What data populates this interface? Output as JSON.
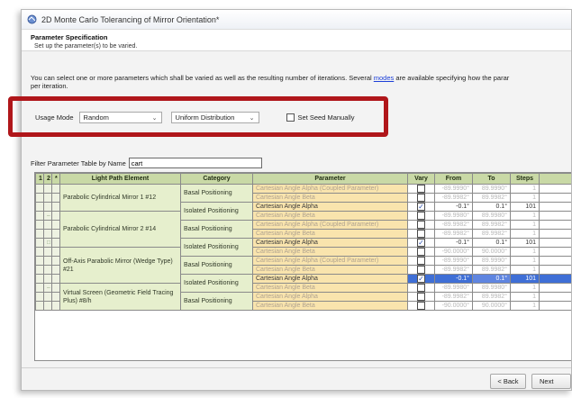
{
  "window": {
    "title": "2D Monte Carlo Tolerancing of Mirror Orientation*"
  },
  "header": {
    "section_title": "Parameter Specification",
    "section_subtitle": "Set up the parameter(s) to be varied."
  },
  "info": {
    "text_before": "You can select one or more parameters which shall be varied as well as the resulting number of iterations. Several ",
    "link": "modes",
    "text_after": " are available specifying how the parar",
    "line2": "per iteration."
  },
  "mode": {
    "label": "Usage Mode",
    "mode_value": "Random",
    "distribution_value": "Uniform Distribution",
    "seed_label": "Set Seed Manually"
  },
  "filter": {
    "label": "Filter Parameter Table by Name",
    "value": "cart"
  },
  "table": {
    "headers": [
      "1",
      "2",
      "*",
      "Light Path Element",
      "Category",
      "Parameter",
      "Vary",
      "From",
      "To",
      "Steps"
    ],
    "tree_markers": [
      "–",
      "□",
      "–"
    ],
    "elements": [
      "Parabolic Cylindrical Mirror 1 #12",
      "Parabolic Cylindrical Mirror 2 #14",
      "Off-Axis Parabolic Mirror (Wedge Type) #21",
      "Virtual Screen (Geometric Field Tracing Plus) #8/h"
    ],
    "categories": [
      "Basal Positioning",
      "Isolated Positioning",
      "Basal Positioning",
      "Isolated Positioning",
      "Basal Positioning",
      "Isolated Positioning",
      "Basal Positioning"
    ],
    "rows": [
      {
        "param": "Cartesian Angle Alpha (Coupled Parameter)",
        "vary": false,
        "from": "-89.9990°",
        "to": "89.9990°",
        "steps": "1"
      },
      {
        "param": "Cartesian Angle Beta",
        "vary": false,
        "from": "-89.9982°",
        "to": "89.9982°",
        "steps": "1"
      },
      {
        "param": "Cartesian Angle Alpha",
        "vary": true,
        "from": "-0.1°",
        "to": "0.1°",
        "steps": "101"
      },
      {
        "param": "Cartesian Angle Beta",
        "vary": false,
        "from": "-89.9980°",
        "to": "89.9980°",
        "steps": "1"
      },
      {
        "param": "Cartesian Angle Alpha (Coupled Parameter)",
        "vary": false,
        "from": "-89.9982°",
        "to": "89.9982°",
        "steps": "1"
      },
      {
        "param": "Cartesian Angle Beta",
        "vary": false,
        "from": "-89.9982°",
        "to": "89.9982°",
        "steps": "1"
      },
      {
        "param": "Cartesian Angle Alpha",
        "vary": true,
        "from": "-0.1°",
        "to": "0.1°",
        "steps": "101"
      },
      {
        "param": "Cartesian Angle Beta",
        "vary": false,
        "from": "-90.0000°",
        "to": "90.0000°",
        "steps": "1"
      },
      {
        "param": "Cartesian Angle Alpha (Coupled Parameter)",
        "vary": false,
        "from": "-89.9990°",
        "to": "89.9990°",
        "steps": "1"
      },
      {
        "param": "Cartesian Angle Beta",
        "vary": false,
        "from": "-89.9982°",
        "to": "89.9982°",
        "steps": "1"
      },
      {
        "param": "Cartesian Angle Alpha",
        "vary": true,
        "from": "-0.1°",
        "to": "0.1°",
        "steps": "101"
      },
      {
        "param": "Cartesian Angle Beta",
        "vary": false,
        "from": "-89.9980°",
        "to": "89.9980°",
        "steps": "1"
      },
      {
        "param": "Cartesian Angle Alpha",
        "vary": false,
        "from": "-89.9982°",
        "to": "89.9982°",
        "steps": "1"
      },
      {
        "param": "Cartesian Angle Beta",
        "vary": false,
        "from": "-90.0000°",
        "to": "90.0000°",
        "steps": "1"
      }
    ]
  },
  "buttons": {
    "back": "< Back",
    "next": "Next"
  },
  "colors": {
    "highlight": "#b0161a",
    "header_green": "#c9d9a6",
    "param_orange": "#f9e4ad",
    "selection": "#3f6fd6"
  }
}
